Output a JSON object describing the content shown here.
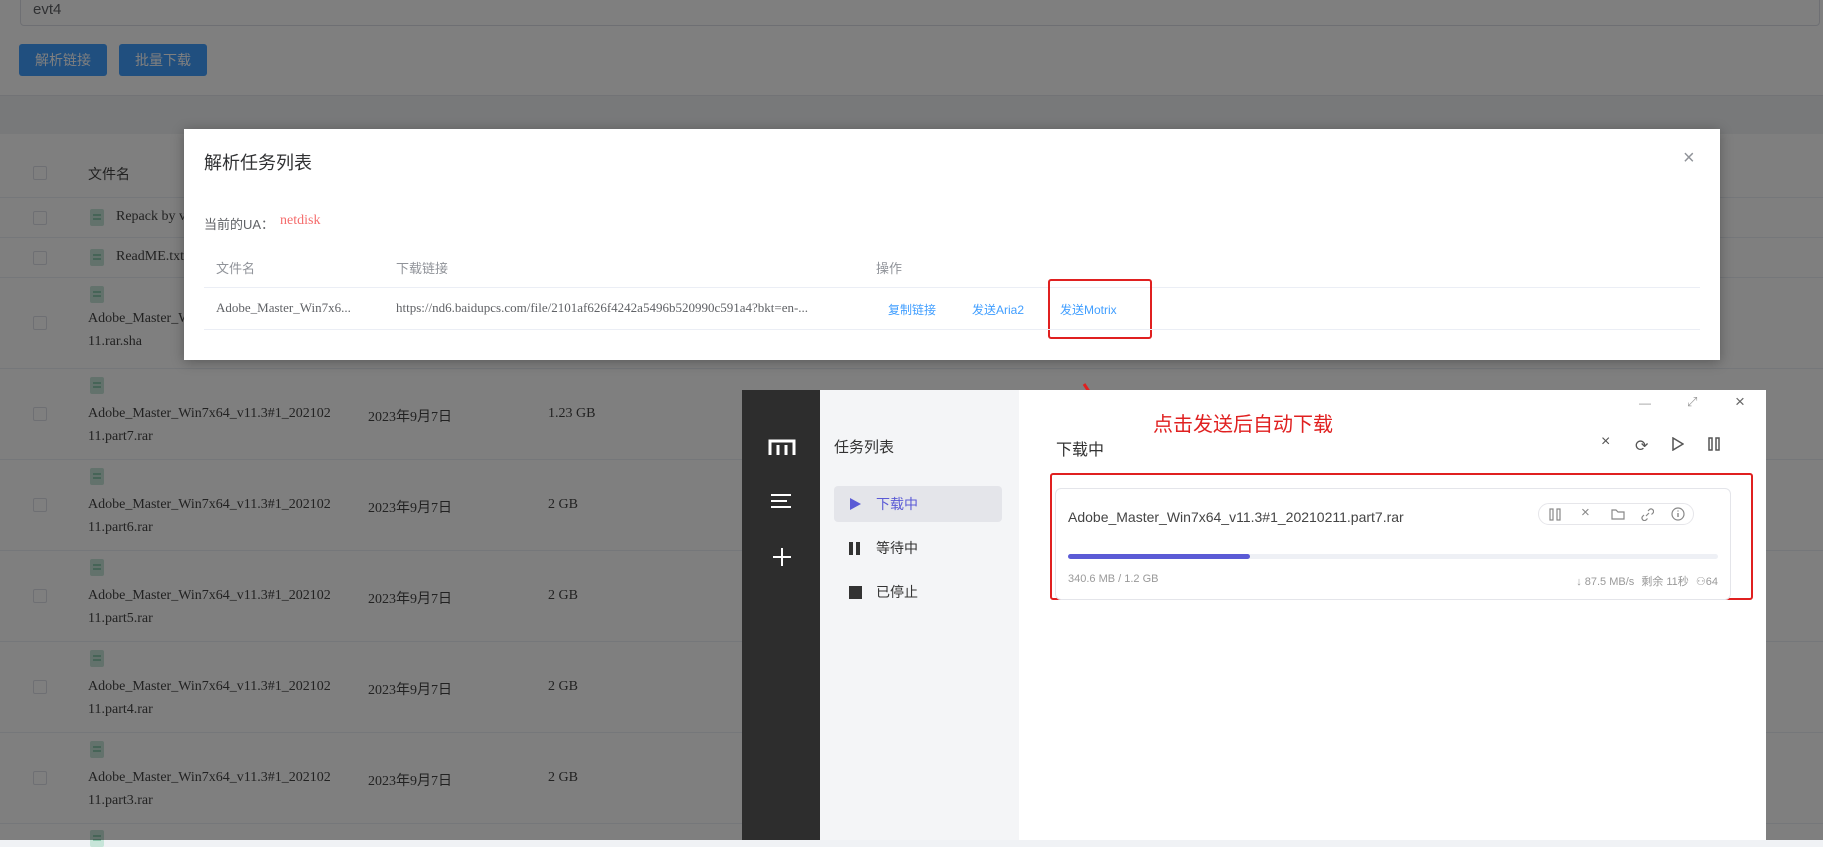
{
  "page": {
    "url_input_value": "evt4",
    "parse_button": "解析链接",
    "batch_button": "批量下载",
    "column_filename": "文件名",
    "rows": [
      {
        "name_line1": "Repack by v",
        "name_line2": "",
        "date": "",
        "size": ""
      },
      {
        "name_line1": "ReadME.txt",
        "name_line2": "",
        "date": "",
        "size": ""
      },
      {
        "name_line1": "Adobe_Master_W",
        "name_line2": "11.rar.sha",
        "date": "",
        "size": ""
      },
      {
        "name_line1": "Adobe_Master_Win7x64_v11.3#1_202102",
        "name_line2": "11.part7.rar",
        "date": "2023年9月7日",
        "size": "1.23 GB"
      },
      {
        "name_line1": "Adobe_Master_Win7x64_v11.3#1_202102",
        "name_line2": "11.part6.rar",
        "date": "2023年9月7日",
        "size": "2 GB"
      },
      {
        "name_line1": "Adobe_Master_Win7x64_v11.3#1_202102",
        "name_line2": "11.part5.rar",
        "date": "2023年9月7日",
        "size": "2 GB"
      },
      {
        "name_line1": "Adobe_Master_Win7x64_v11.3#1_202102",
        "name_line2": "11.part4.rar",
        "date": "2023年9月7日",
        "size": "2 GB"
      },
      {
        "name_line1": "Adobe_Master_Win7x64_v11.3#1_202102",
        "name_line2": "11.part3.rar",
        "date": "2023年9月7日",
        "size": "2 GB"
      }
    ]
  },
  "dialog": {
    "title": "解析任务列表",
    "close": "×",
    "ua_label": "当前的UA：",
    "ua_value": "netdisk",
    "col_filename": "文件名",
    "col_link": "下载链接",
    "col_actions": "操作",
    "row": {
      "filename": "Adobe_Master_Win7x6...",
      "link": "https://nd6.baidupcs.com/file/2101af626f4242a5496b520990c591a4?bkt=en-...",
      "copy": "复制链接",
      "aria2": "发送Aria2",
      "motrix": "发送Motrix"
    }
  },
  "motrix": {
    "list_title": "任务列表",
    "menu": [
      {
        "label": "下载中",
        "icon": "play-icon"
      },
      {
        "label": "等待中",
        "icon": "pause-icon"
      },
      {
        "label": "已停止",
        "icon": "stop-icon"
      }
    ],
    "header": "下载中",
    "task": {
      "name": "Adobe_Master_Win7x64_v11.3#1_20210211.part7.rar",
      "progress": 0.28,
      "downloaded": "340.6 MB / 1.2 GB",
      "speed": "↓ 87.5 MB/s",
      "remaining": "剩余 11秒",
      "connections": "64"
    },
    "accent": "#5b5bd6"
  },
  "annotation": {
    "note": "点击发送后自动下载",
    "color": "#e02020"
  }
}
